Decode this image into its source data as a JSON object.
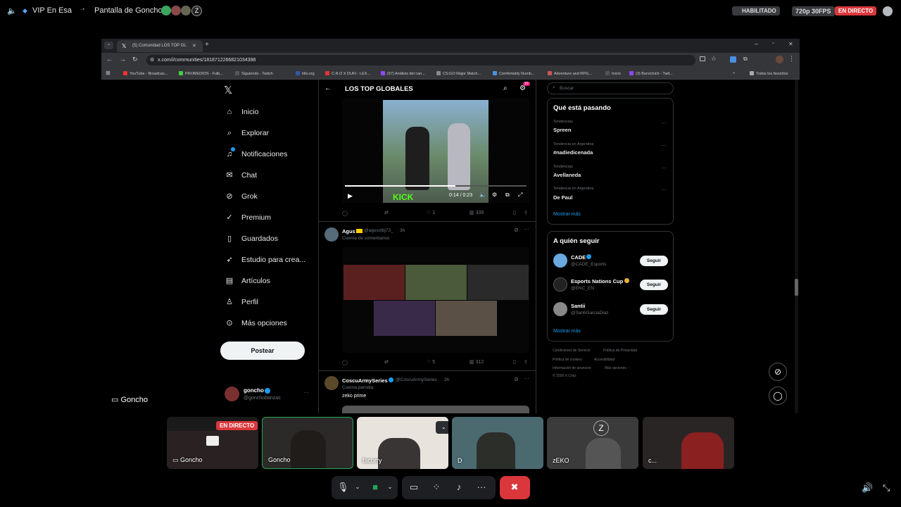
{
  "discord": {
    "server": "VIP En Esa",
    "stream_title": "Pantalla de Goncho",
    "habilitado": "HABILITADO",
    "quality": "720p 30FPS",
    "live_badge": "EN DIRECTO",
    "streamer_overlay": "Goncho"
  },
  "browser": {
    "tab_title": "(5) Comunidad LOS TOP GL",
    "url": "x.com/i/communities/1818712266821034398",
    "bookmarks": [
      "YouTube - Broadcas...",
      "PROMEDIOS - Fulb...",
      "Siguiendo - Twitch",
      "hltv.org",
      "C.R.O X DUKI - LEX...",
      "(57) Análisis del can...",
      "CS:GO Major Match...",
      "Comfortably Numb...",
      "Adventure and RPG...",
      "Inicio",
      "(3) Borvichich - Twit..."
    ],
    "bookmarks_all": "Todos los favoritos"
  },
  "x": {
    "nav": [
      "Inicio",
      "Explorar",
      "Notificaciones",
      "Chat",
      "Grok",
      "Premium",
      "Guardados",
      "Estudio para crea...",
      "Artículos",
      "Perfil",
      "Más opciones"
    ],
    "notif_badge": "10",
    "post_button": "Postear",
    "account_name": "goncho",
    "account_handle": "@gonchobanzas",
    "community_title": "LOS TOP GLOBALES",
    "video_time": "0:14 / 0:23",
    "video_brand": "KICK",
    "tweet1_actions": {
      "likes": "1",
      "views": "339"
    },
    "tweet2": {
      "name": "Agus",
      "handle": "@agusstbj73_",
      "time": "· 3h",
      "tag": "Cuenta de comentarios",
      "likes": "5",
      "views": "312"
    },
    "tweet3": {
      "name": "CoscuArmySeries",
      "handle": "@CoscuArmySeries",
      "time": "· 3h",
      "tag": "Cuenta parodia",
      "text": "zeko prime"
    },
    "search_placeholder": "Buscar",
    "trends_title": "Qué está pasando",
    "trends": [
      {
        "context": "Tendencias",
        "name": "Spreen"
      },
      {
        "context": "Tendencia en Argentina",
        "name": "#nadiedicenada"
      },
      {
        "context": "Tendencias",
        "name": "Avellaneda"
      },
      {
        "context": "Tendencia en Argentina",
        "name": "De Paul"
      }
    ],
    "show_more": "Mostrar más",
    "follow_title": "A quién seguir",
    "follow": [
      {
        "name": "CADE",
        "handle": "@CADE_Esports",
        "btn": "Seguir"
      },
      {
        "name": "Esports Nations Cup",
        "handle": "@ENC_EN",
        "btn": "Seguir"
      },
      {
        "name": "Santii",
        "handle": "@SantiGarciaDiaz",
        "btn": "Seguir"
      }
    ],
    "footer": [
      "Condiciones de Servicio",
      "Política de Privacidad",
      "Política de cookies",
      "Accesibilidad",
      "Información de anuncios",
      "Más opciones ···",
      "© 2026 X Corp."
    ]
  },
  "participants": [
    {
      "name": "Goncho",
      "live": "EN DIRECTO"
    },
    {
      "name": "Goncho"
    },
    {
      "name": "facurry"
    },
    {
      "name": "D"
    },
    {
      "name": "zEKO"
    },
    {
      "name": "c..."
    }
  ],
  "colors": {
    "live": "#da373c",
    "x_blue": "#1d9bf0",
    "discord_green": "#23a55a",
    "end_call": "#da373c"
  }
}
